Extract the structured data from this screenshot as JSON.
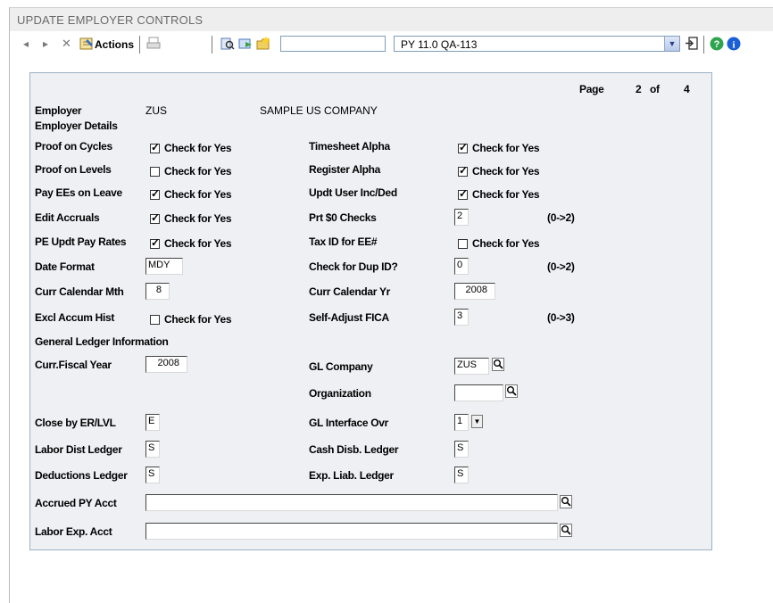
{
  "window": {
    "title": "UPDATE EMPLOYER CONTROLS"
  },
  "toolbar": {
    "actions_label": "Actions",
    "product_select": "PY 11.0 QA-113"
  },
  "page": {
    "label": "Page",
    "current": "2",
    "of_label": "of",
    "total": "4"
  },
  "employer": {
    "label": "Employer",
    "code": "ZUS",
    "name": "SAMPLE US COMPANY",
    "details_heading": "Employer Details"
  },
  "check_text": "Check for Yes",
  "fields": {
    "proof_cycles": {
      "label": "Proof on Cycles",
      "checked": true
    },
    "proof_levels": {
      "label": "Proof on Levels",
      "checked": false
    },
    "pay_ees_leave": {
      "label": "Pay EEs on Leave",
      "checked": true
    },
    "edit_accruals": {
      "label": "Edit Accruals",
      "checked": true
    },
    "pe_updt_rates": {
      "label": "PE Updt Pay Rates",
      "checked": true
    },
    "date_format": {
      "label": "Date Format",
      "value": "MDY"
    },
    "curr_cal_mth": {
      "label": "Curr Calendar Mth",
      "value": "8"
    },
    "excl_accum": {
      "label": "Excl Accum Hist",
      "checked": false
    },
    "timesheet_alpha": {
      "label": "Timesheet Alpha",
      "checked": true
    },
    "register_alpha": {
      "label": "Register Alpha",
      "checked": true
    },
    "updt_user_incded": {
      "label": "Updt User Inc/Ded",
      "checked": true
    },
    "prt_zero_checks": {
      "label": "Prt $0 Checks",
      "value": "2",
      "hint": "(0->2)"
    },
    "tax_id_ee": {
      "label": "Tax ID for EE#",
      "checked": false
    },
    "check_dup_id": {
      "label": "Check for Dup ID?",
      "value": "0",
      "hint": "(0->2)"
    },
    "curr_cal_yr": {
      "label": "Curr Calendar Yr",
      "value": "2008"
    },
    "self_adjust_fica": {
      "label": "Self-Adjust FICA",
      "value": "3",
      "hint": "(0->3)"
    }
  },
  "gl": {
    "heading": "General Ledger Information",
    "curr_fiscal_year": {
      "label": "Curr.Fiscal Year",
      "value": "2008"
    },
    "gl_company": {
      "label": "GL Company",
      "value": "ZUS"
    },
    "organization": {
      "label": "Organization",
      "value": ""
    },
    "close_by": {
      "label": "Close by ER/LVL",
      "value": "E"
    },
    "gl_interface_ovr": {
      "label": "GL Interface Ovr",
      "value": "1"
    },
    "labor_dist_ledger": {
      "label": "Labor Dist Ledger",
      "value": "S"
    },
    "cash_disb_ledger": {
      "label": "Cash Disb. Ledger",
      "value": "S"
    },
    "deductions_ledger": {
      "label": "Deductions Ledger",
      "value": "S"
    },
    "exp_liab_ledger": {
      "label": "Exp. Liab. Ledger",
      "value": "S"
    },
    "accrued_py_acct": {
      "label": "Accrued PY Acct",
      "value": ""
    },
    "labor_exp_acct": {
      "label": "Labor Exp. Acct",
      "value": ""
    }
  },
  "colors": {
    "panel_bg": "#eef0f4",
    "panel_border": "#9db0c4",
    "title_bg": "#eeeeee",
    "help_icon": "#2ea44f",
    "info_icon": "#1a5fd6"
  }
}
